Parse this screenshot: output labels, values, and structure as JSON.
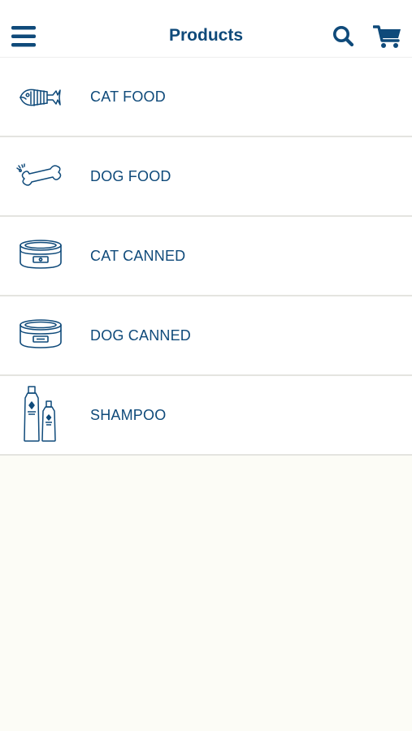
{
  "header": {
    "title": "Products",
    "menu_icon": "hamburger-menu-icon",
    "search_icon": "search-icon",
    "cart_icon": "shopping-cart-icon"
  },
  "categories": [
    {
      "label": "CAT FOOD",
      "icon": "fish-bone-icon"
    },
    {
      "label": "DOG FOOD",
      "icon": "dog-bone-icon"
    },
    {
      "label": "CAT CANNED",
      "icon": "cat-can-icon"
    },
    {
      "label": "DOG CANNED",
      "icon": "dog-can-icon"
    },
    {
      "label": "SHAMPOO",
      "icon": "shampoo-bottles-icon"
    }
  ],
  "colors": {
    "primary": "#0f4a7a",
    "background": "#fcfcf6",
    "row_background": "#ffffff",
    "divider": "#e4e4e0"
  }
}
